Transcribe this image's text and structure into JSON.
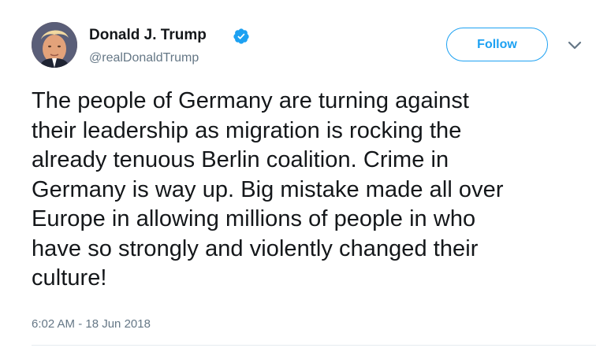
{
  "tweet": {
    "author": {
      "display_name": "Donald J. Trump",
      "handle": "@realDonaldTrump",
      "verified": true
    },
    "follow_label": "Follow",
    "text_lines": [
      "The people of Germany are turning against",
      "their leadership as migration is rocking the",
      "already tenuous Berlin coalition. Crime in",
      "Germany is way up. Big mistake made all over",
      "Europe in allowing millions of people in who",
      "have so strongly and violently changed their",
      "culture!"
    ],
    "timestamp": "6:02 AM - 18 Jun 2018"
  },
  "icons": {
    "verified": "verified-badge-icon",
    "more": "chevron-down-icon"
  },
  "colors": {
    "accent": "#1da1f2",
    "text": "#14171a",
    "muted": "#657786"
  }
}
